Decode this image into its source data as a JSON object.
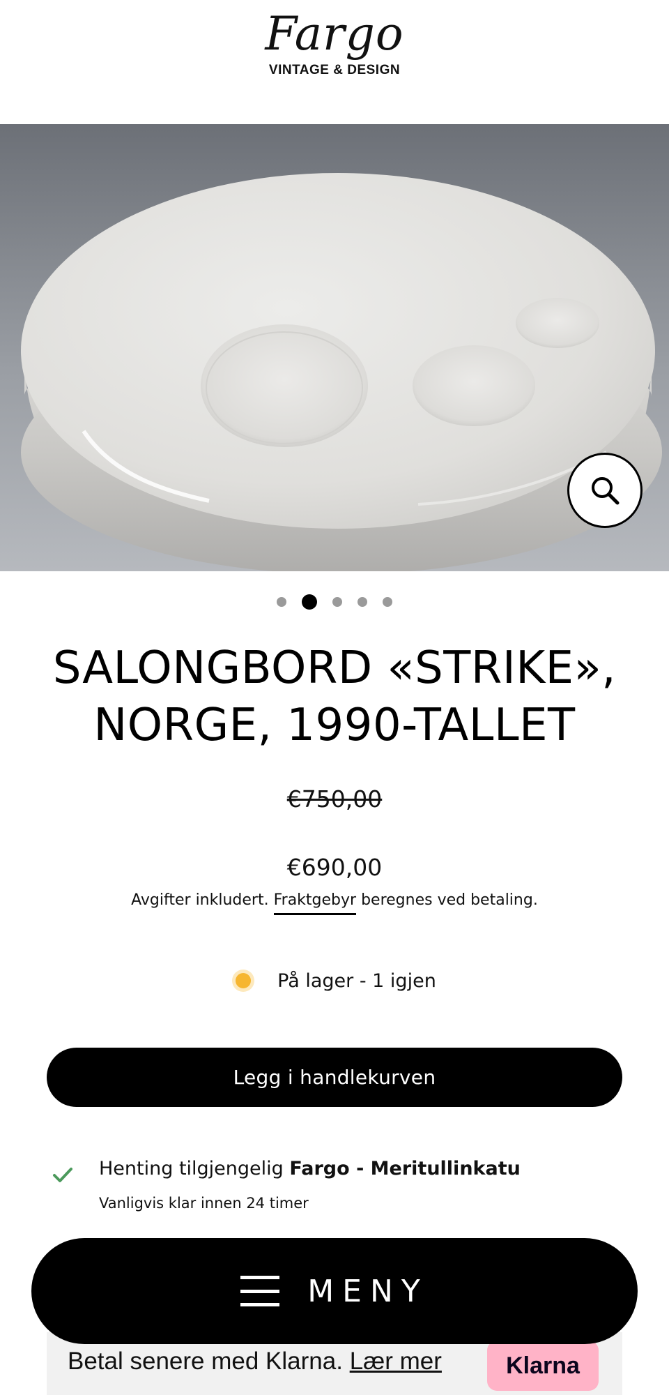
{
  "header": {
    "logo_script": "Fargo",
    "logo_subtitle": "VINTAGE & DESIGN"
  },
  "gallery": {
    "zoom_icon": "search-icon",
    "dots_count": 5,
    "active_dot": 2
  },
  "product": {
    "title": "SALONGBORD «STRIKE», NORGE, 1990-TALLET",
    "price_original": "€750,00",
    "price_sale": "€690,00",
    "tax_prefix": "Avgifter inkludert.",
    "shipping_link": "Fraktgebyr",
    "tax_suffix": "beregnes ved betaling."
  },
  "stock": {
    "text": "På lager - 1 igjen",
    "dot_color": "#f6b631"
  },
  "cart": {
    "add_label": "Legg i handlekurven"
  },
  "pickup": {
    "prefix": "Henting tilgjengelig",
    "location": "Fargo - Meritullinkatu",
    "subtext": "Vanligvis klar innen 24 timer",
    "check_color": "#4c9a5c"
  },
  "klarna": {
    "text": "Betal senere med Klarna.",
    "link": "Lær mer",
    "badge": "Klarna",
    "badge_color": "#ffb3c7"
  },
  "menu": {
    "label": "MENY",
    "icon": "hamburger-icon"
  }
}
